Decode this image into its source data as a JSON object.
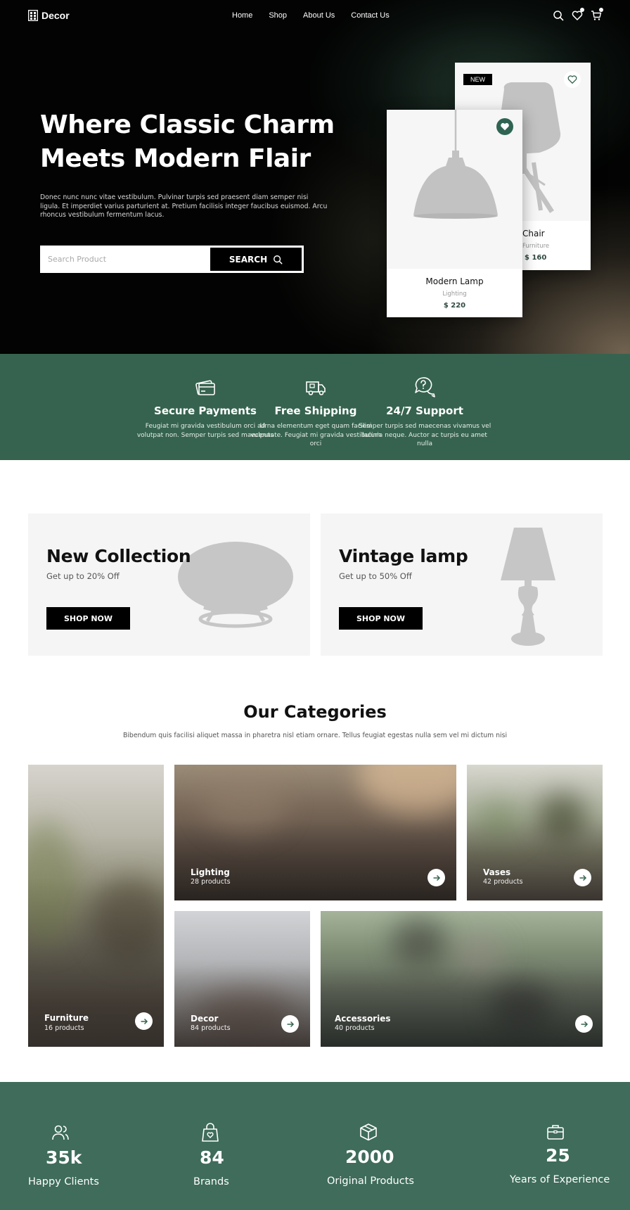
{
  "brand": {
    "name": "Decor"
  },
  "nav": {
    "links": [
      "Home",
      "Shop",
      "About Us",
      "Contact Us"
    ],
    "icons": [
      "search-icon",
      "heart-icon",
      "cart-icon"
    ]
  },
  "hero": {
    "title_line1": "Where Classic Charm",
    "title_line2": "Meets Modern Flair",
    "text": "Donec nunc nunc vitae vestibulum. Pulvinar turpis sed praesent diam semper nisi ligula. Et imperdiet varius parturient at. Pretium facilisis integer faucibus euismod. Arcu rhoncus vestibulum fermentum lacus.",
    "search_placeholder": "Search Product",
    "search_button": "SEARCH"
  },
  "products": [
    {
      "badge": "NEW",
      "name": "Chair",
      "category": "Furniture",
      "price": "$ 160",
      "favorited": false
    },
    {
      "name": "Modern Lamp",
      "category": "Lighting",
      "price": "$ 220",
      "favorited": true
    }
  ],
  "features": [
    {
      "icon": "credit-card-icon",
      "title": "Secure Payments",
      "text": "Feugiat mi gravida vestibulum orci ad volutpat non. Semper turpis sed maecenas"
    },
    {
      "icon": "truck-icon",
      "title": "Free Shipping",
      "text": "Urna elementum eget quam facilisi vulputate. Feugiat mi gravida vestibulum orci"
    },
    {
      "icon": "support-chat-icon",
      "title": "24/7 Support",
      "text": "Semper turpis sed maecenas vivamus vel lacinia neque. Auctor ac turpis eu amet nulla"
    }
  ],
  "promos": [
    {
      "title": "New Collection",
      "subtitle": "Get up to 20% Off",
      "button": "SHOP NOW"
    },
    {
      "title": "Vintage lamp",
      "subtitle": "Get up to 50% Off",
      "button": "SHOP NOW"
    }
  ],
  "categories": {
    "heading": "Our Categories",
    "subtitle": "Bibendum quis facilisi aliquet massa in pharetra nisl etiam ornare. Tellus feugiat egestas nulla sem vel mi dictum nisi",
    "items": [
      {
        "name": "Furniture",
        "count": "16 products"
      },
      {
        "name": "Lighting",
        "count": "28 products"
      },
      {
        "name": "Vases",
        "count": "42 products"
      },
      {
        "name": "Decor",
        "count": "84 products"
      },
      {
        "name": "Accessories",
        "count": "40 products"
      }
    ]
  },
  "stats": [
    {
      "icon": "users-icon",
      "value": "35k",
      "label": "Happy Clients"
    },
    {
      "icon": "shopping-bag-icon",
      "value": "84",
      "label": "Brands"
    },
    {
      "icon": "box-icon",
      "value": "2000",
      "label": "Original Products"
    },
    {
      "icon": "briefcase-icon",
      "value": "25",
      "label": "Years of Experience"
    }
  ],
  "colors": {
    "accent": "#36634f",
    "stats_bg": "#3f6c5b",
    "dark": "#000000"
  }
}
